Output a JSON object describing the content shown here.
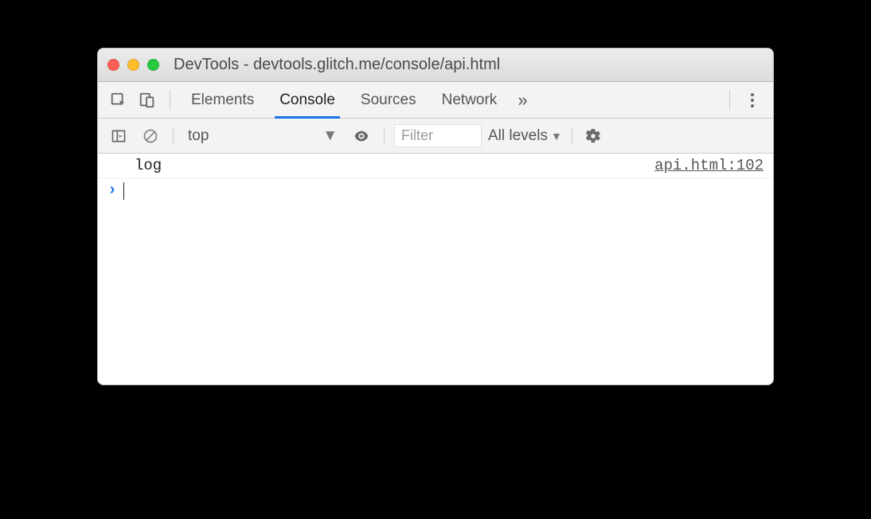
{
  "window": {
    "title": "DevTools - devtools.glitch.me/console/api.html"
  },
  "tabs": {
    "items": [
      "Elements",
      "Console",
      "Sources",
      "Network"
    ],
    "active": "Console",
    "more": "»"
  },
  "toolbar": {
    "context": "top",
    "filter_placeholder": "Filter",
    "levels": "All levels"
  },
  "console": {
    "entries": [
      {
        "message": "log",
        "source": "api.html:102"
      }
    ]
  }
}
